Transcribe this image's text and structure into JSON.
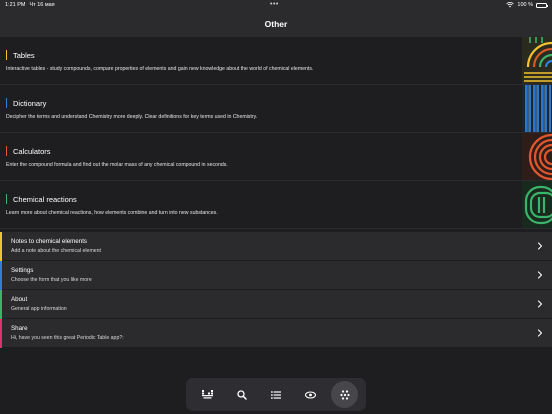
{
  "status": {
    "time": "1:21 PM",
    "date": "Чт 16 мая",
    "battery": "100 %"
  },
  "header": {
    "title": "Other"
  },
  "cards": [
    {
      "title": "Tables",
      "desc": "Interactive tables - study compounds, compare properties of elements and gain new knowledge about the world of chemical elements.",
      "accent": "#f2c230"
    },
    {
      "title": "Dictionary",
      "desc": "Decipher the terms and understand Chemistry more deeply. Clear definitions for key terms used in Chemistry.",
      "accent": "#2e7fd6"
    },
    {
      "title": "Calculators",
      "desc": "Enter the compound formula and find out the molar mass of any chemical compound in seconds.",
      "accent": "#e1582f"
    },
    {
      "title": "Chemical reactions",
      "desc": "Learn more about chemical reactions, how elements combine and turn into new substances.",
      "accent": "#3bb36a"
    }
  ],
  "menu": [
    {
      "title": "Notes to chemical elements",
      "sub": "Add a note about the chemical element",
      "accent": "#f2c230"
    },
    {
      "title": "Settings",
      "sub": "Choose the form that you like more",
      "accent": "#2e7fd6"
    },
    {
      "title": "About",
      "sub": "General app information",
      "accent": "#3bb36a"
    },
    {
      "title": "Share",
      "sub": "Hi, have you seen this great Periodic Table app?:",
      "accent": "#e0316a"
    }
  ],
  "tabs": [
    {
      "icon": "periodic-table-icon",
      "active": false
    },
    {
      "icon": "search-icon",
      "active": false
    },
    {
      "icon": "list-icon",
      "active": false
    },
    {
      "icon": "atom-icon",
      "active": false
    },
    {
      "icon": "grid-dots-icon",
      "active": true
    }
  ]
}
